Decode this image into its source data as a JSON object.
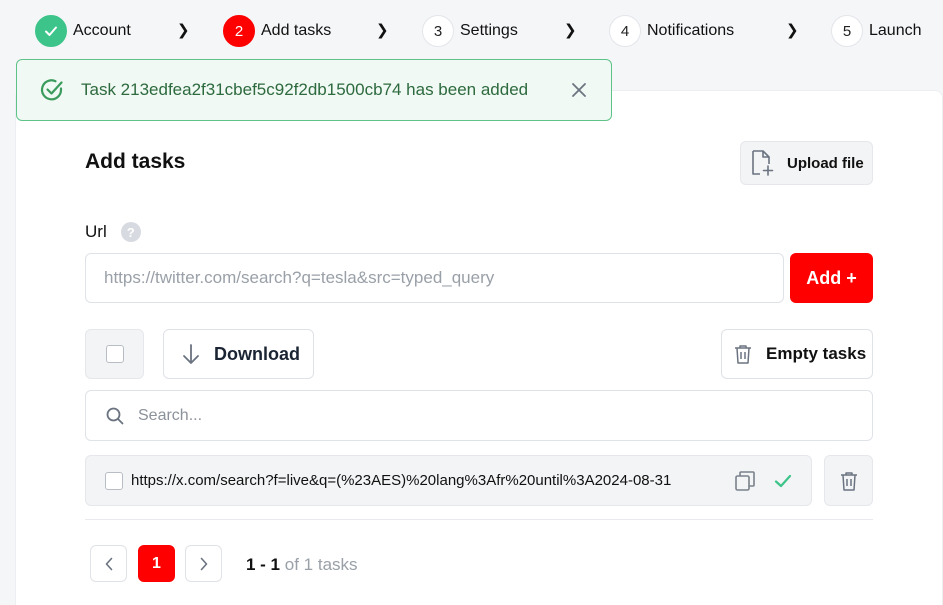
{
  "stepper": {
    "steps": [
      {
        "number": "",
        "label": "Account",
        "state": "done"
      },
      {
        "number": "2",
        "label": "Add tasks",
        "state": "active"
      },
      {
        "number": "3",
        "label": "Settings",
        "state": "pending"
      },
      {
        "number": "4",
        "label": "Notifications",
        "state": "pending"
      },
      {
        "number": "5",
        "label": "Launch",
        "state": "pending"
      }
    ],
    "separator_icon": "chevron-right-icon"
  },
  "toast": {
    "message": "Task 213edfea2f31cbef5c92f2db1500cb74 has been added",
    "status_color": "#3cc48a"
  },
  "page": {
    "title": "Add tasks",
    "upload_label": "Upload file",
    "url_label": "Url",
    "help_glyph": "?",
    "url_placeholder": "https://twitter.com/search?q=tesla&src=typed_query",
    "add_label": "Add +",
    "download_label": "Download",
    "empty_label": "Empty tasks",
    "search_placeholder": "Search..."
  },
  "tasks": [
    {
      "url": "https://x.com/search?f=live&q=(%23AES)%20lang%3Afr%20until%3A2024-08-31",
      "status": "added"
    }
  ],
  "pagination": {
    "current_page": "1",
    "range": "1 - 1",
    "of_text": "of 1 tasks"
  },
  "colors": {
    "accent": "#ff0000",
    "success": "#3cc48a"
  }
}
